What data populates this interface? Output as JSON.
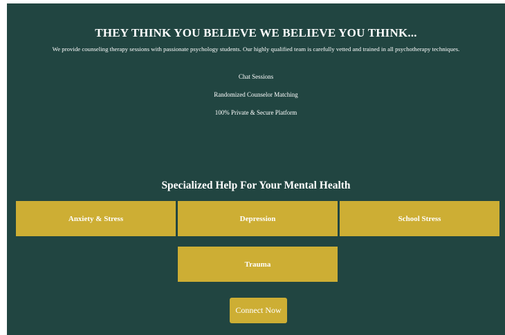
{
  "hero": {
    "title": "THEY THINK YOU BELIEVE WE BELIEVE YOU THINK...",
    "description": "We provide counseling therapy sessions with passionate psychology students. Our highly qualified team is carefully vetted and trained in all psychotherapy techniques."
  },
  "features": [
    "Chat Sessions",
    "Randomized Counselor Matching",
    "100% Private & Secure Platform"
  ],
  "specialized": {
    "title": "Specialized Help For Your Mental Health",
    "cards": [
      "Anxiety & Stress",
      "Depression",
      "School Stress",
      "Trauma"
    ]
  },
  "cta": {
    "label": "Connect Now"
  },
  "colors": {
    "background": "#214541",
    "accent": "#cdae34",
    "text": "#ffffff"
  }
}
